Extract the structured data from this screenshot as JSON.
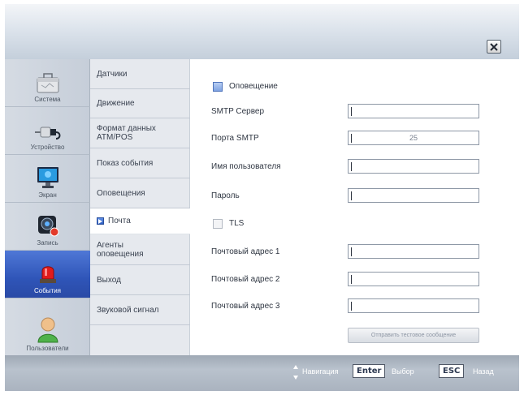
{
  "icons": {
    "close": "close-icon",
    "system": "briefcase-icon",
    "devices": "plug-icon",
    "screen": "monitor-icon",
    "record": "camera-icon",
    "events": "alarm-light-icon",
    "users": "user-icon",
    "nav": "up-down-arrows-icon",
    "active_menu": "right-triangle-icon"
  },
  "sidebar": {
    "items": [
      {
        "label": "Система"
      },
      {
        "label": "Устройство"
      },
      {
        "label": "Экран"
      },
      {
        "label": "Запись"
      },
      {
        "label": "События",
        "active": true
      },
      {
        "label": "Пользователи"
      }
    ]
  },
  "menu": {
    "items": [
      {
        "label": "Датчики"
      },
      {
        "label": "Движение"
      },
      {
        "label": "Формат данных ATM/POS"
      },
      {
        "label": "Показ события"
      },
      {
        "label": "Оповещения"
      },
      {
        "label": "Почта",
        "active": true
      },
      {
        "label": "Агенты оповещения"
      },
      {
        "label": "Выход"
      },
      {
        "label": "Звуковой сигнал"
      }
    ]
  },
  "form": {
    "notify_label": "Оповещение",
    "smtp_server_label": "SMTP Сервер",
    "smtp_server_value": "",
    "smtp_port_label": "Порта SMTP",
    "smtp_port_value": "25",
    "username_label": "Имя пользователя",
    "username_value": "",
    "password_label": "Пароль",
    "password_value": "",
    "tls_label": "TLS",
    "mail1_label": "Почтовый адрес 1",
    "mail1_value": "",
    "mail2_label": "Почтовый адрес 2",
    "mail2_value": "",
    "mail3_label": "Почтовый адрес 3",
    "mail3_value": "",
    "send_test_label": "Отправить тестовое сообщение"
  },
  "footer": {
    "nav_label": "Навигация",
    "enter_key": "Enter",
    "enter_label": "Выбор",
    "esc_key": "ESC",
    "esc_label": "Назад"
  },
  "colors": {
    "active_sidebar": "#3a63c6",
    "titlebar": "#c4cfdb",
    "footer": "#aab3bf"
  }
}
